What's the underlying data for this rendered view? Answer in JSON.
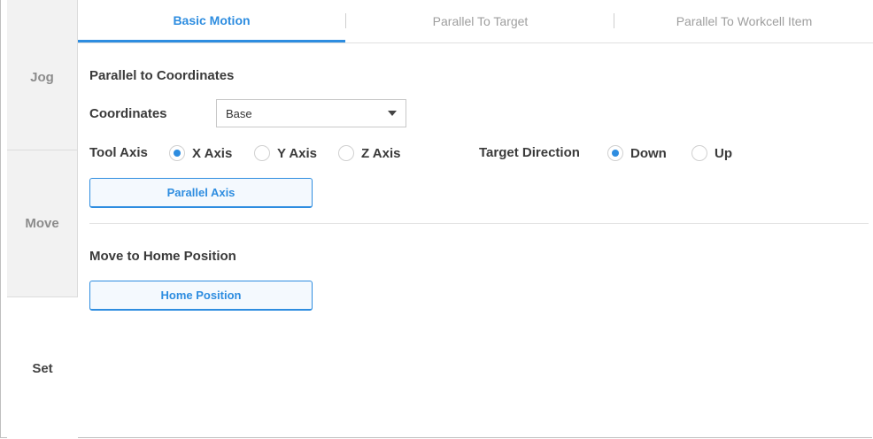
{
  "sidenav": {
    "items": [
      {
        "label": "Jog"
      },
      {
        "label": "Move"
      },
      {
        "label": "Set"
      }
    ],
    "active": "Set"
  },
  "tabs": [
    {
      "label": "Basic Motion",
      "active": true
    },
    {
      "label": "Parallel To Target",
      "active": false
    },
    {
      "label": "Parallel To Workcell Item",
      "active": false
    }
  ],
  "parallel": {
    "title": "Parallel to Coordinates",
    "coordinates_label": "Coordinates",
    "coordinates_value": "Base",
    "tool_axis_label": "Tool Axis",
    "tool_axis_options": [
      "X Axis",
      "Y Axis",
      "Z Axis"
    ],
    "tool_axis_selected": "X Axis",
    "target_direction_label": "Target Direction",
    "target_direction_options": [
      "Down",
      "Up"
    ],
    "target_direction_selected": "Down",
    "button_label": "Parallel Axis"
  },
  "home": {
    "title": "Move to Home Position",
    "button_label": "Home Position"
  },
  "colors": {
    "accent": "#2e8de0",
    "inactive_nav_bg": "#f2f2f2"
  }
}
